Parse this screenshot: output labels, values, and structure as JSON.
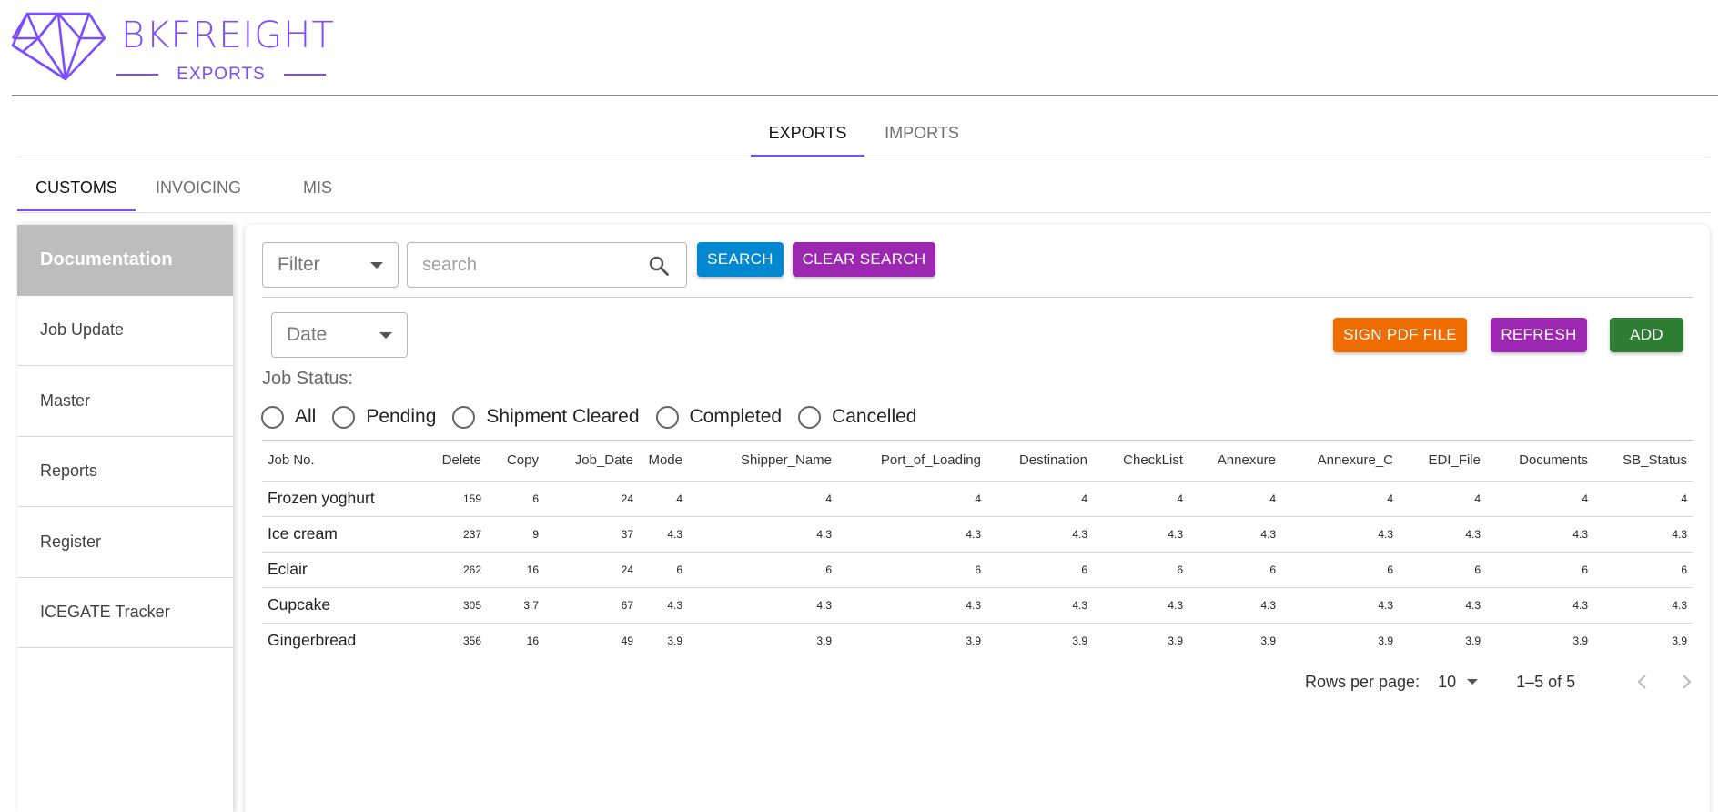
{
  "brand": {
    "name": "BKFREIGHT",
    "subtitle": "EXPORTS",
    "accent_color": "#7c4dff",
    "logo_icon": "diamond-icon"
  },
  "top_tabs": [
    {
      "label": "EXPORTS",
      "active": true
    },
    {
      "label": "IMPORTS",
      "active": false
    }
  ],
  "sub_tabs": [
    {
      "label": "CUSTOMS",
      "active": true
    },
    {
      "label": "INVOICING",
      "active": false
    },
    {
      "label": "MIS",
      "active": false
    }
  ],
  "sidebar": {
    "items": [
      {
        "label": "Documentation",
        "active": true
      },
      {
        "label": "Job Update",
        "active": false
      },
      {
        "label": "Master",
        "active": false
      },
      {
        "label": "Reports",
        "active": false
      },
      {
        "label": "Register",
        "active": false
      },
      {
        "label": "ICEGATE Tracker",
        "active": false
      }
    ]
  },
  "toolbar": {
    "filter_value": "Filter",
    "search_placeholder": "search",
    "search_value": "",
    "search_label": "SEARCH",
    "clear_search_label": "CLEAR SEARCH",
    "date_value": "Date",
    "sign_pdf_label": "SIGN PDF FILE",
    "refresh_label": "REFRESH",
    "add_label": "ADD",
    "colors": {
      "search": "#0288d1",
      "clear_search": "#9c27b0",
      "sign_pdf": "#ef6c00",
      "refresh": "#9c27b0",
      "add": "#2e7d32"
    }
  },
  "job_status": {
    "label": "Job Status:",
    "options": [
      "All",
      "Pending",
      "Shipment Cleared",
      "Completed",
      "Cancelled"
    ],
    "selected": null
  },
  "table": {
    "columns": [
      "Job No.",
      "Delete",
      "Copy",
      "Job_Date",
      "Mode",
      "Shipper_Name",
      "Port_of_Loading",
      "Destination",
      "CheckList",
      "Annexure",
      "Annexure_C",
      "EDI_File",
      "Documents",
      "SB_Status"
    ],
    "rows": [
      [
        "Frozen yoghurt",
        "159",
        "6",
        "24",
        "4",
        "4",
        "4",
        "4",
        "4",
        "4",
        "4",
        "4",
        "4",
        "4"
      ],
      [
        "Ice cream",
        "237",
        "9",
        "37",
        "4.3",
        "4.3",
        "4.3",
        "4.3",
        "4.3",
        "4.3",
        "4.3",
        "4.3",
        "4.3",
        "4.3"
      ],
      [
        "Eclair",
        "262",
        "16",
        "24",
        "6",
        "6",
        "6",
        "6",
        "6",
        "6",
        "6",
        "6",
        "6",
        "6"
      ],
      [
        "Cupcake",
        "305",
        "3.7",
        "67",
        "4.3",
        "4.3",
        "4.3",
        "4.3",
        "4.3",
        "4.3",
        "4.3",
        "4.3",
        "4.3",
        "4.3"
      ],
      [
        "Gingerbread",
        "356",
        "16",
        "49",
        "3.9",
        "3.9",
        "3.9",
        "3.9",
        "3.9",
        "3.9",
        "3.9",
        "3.9",
        "3.9",
        "3.9"
      ]
    ]
  },
  "pagination": {
    "rows_per_page_label": "Rows per page:",
    "rows_per_page": "10",
    "range": "1–5 of 5"
  }
}
